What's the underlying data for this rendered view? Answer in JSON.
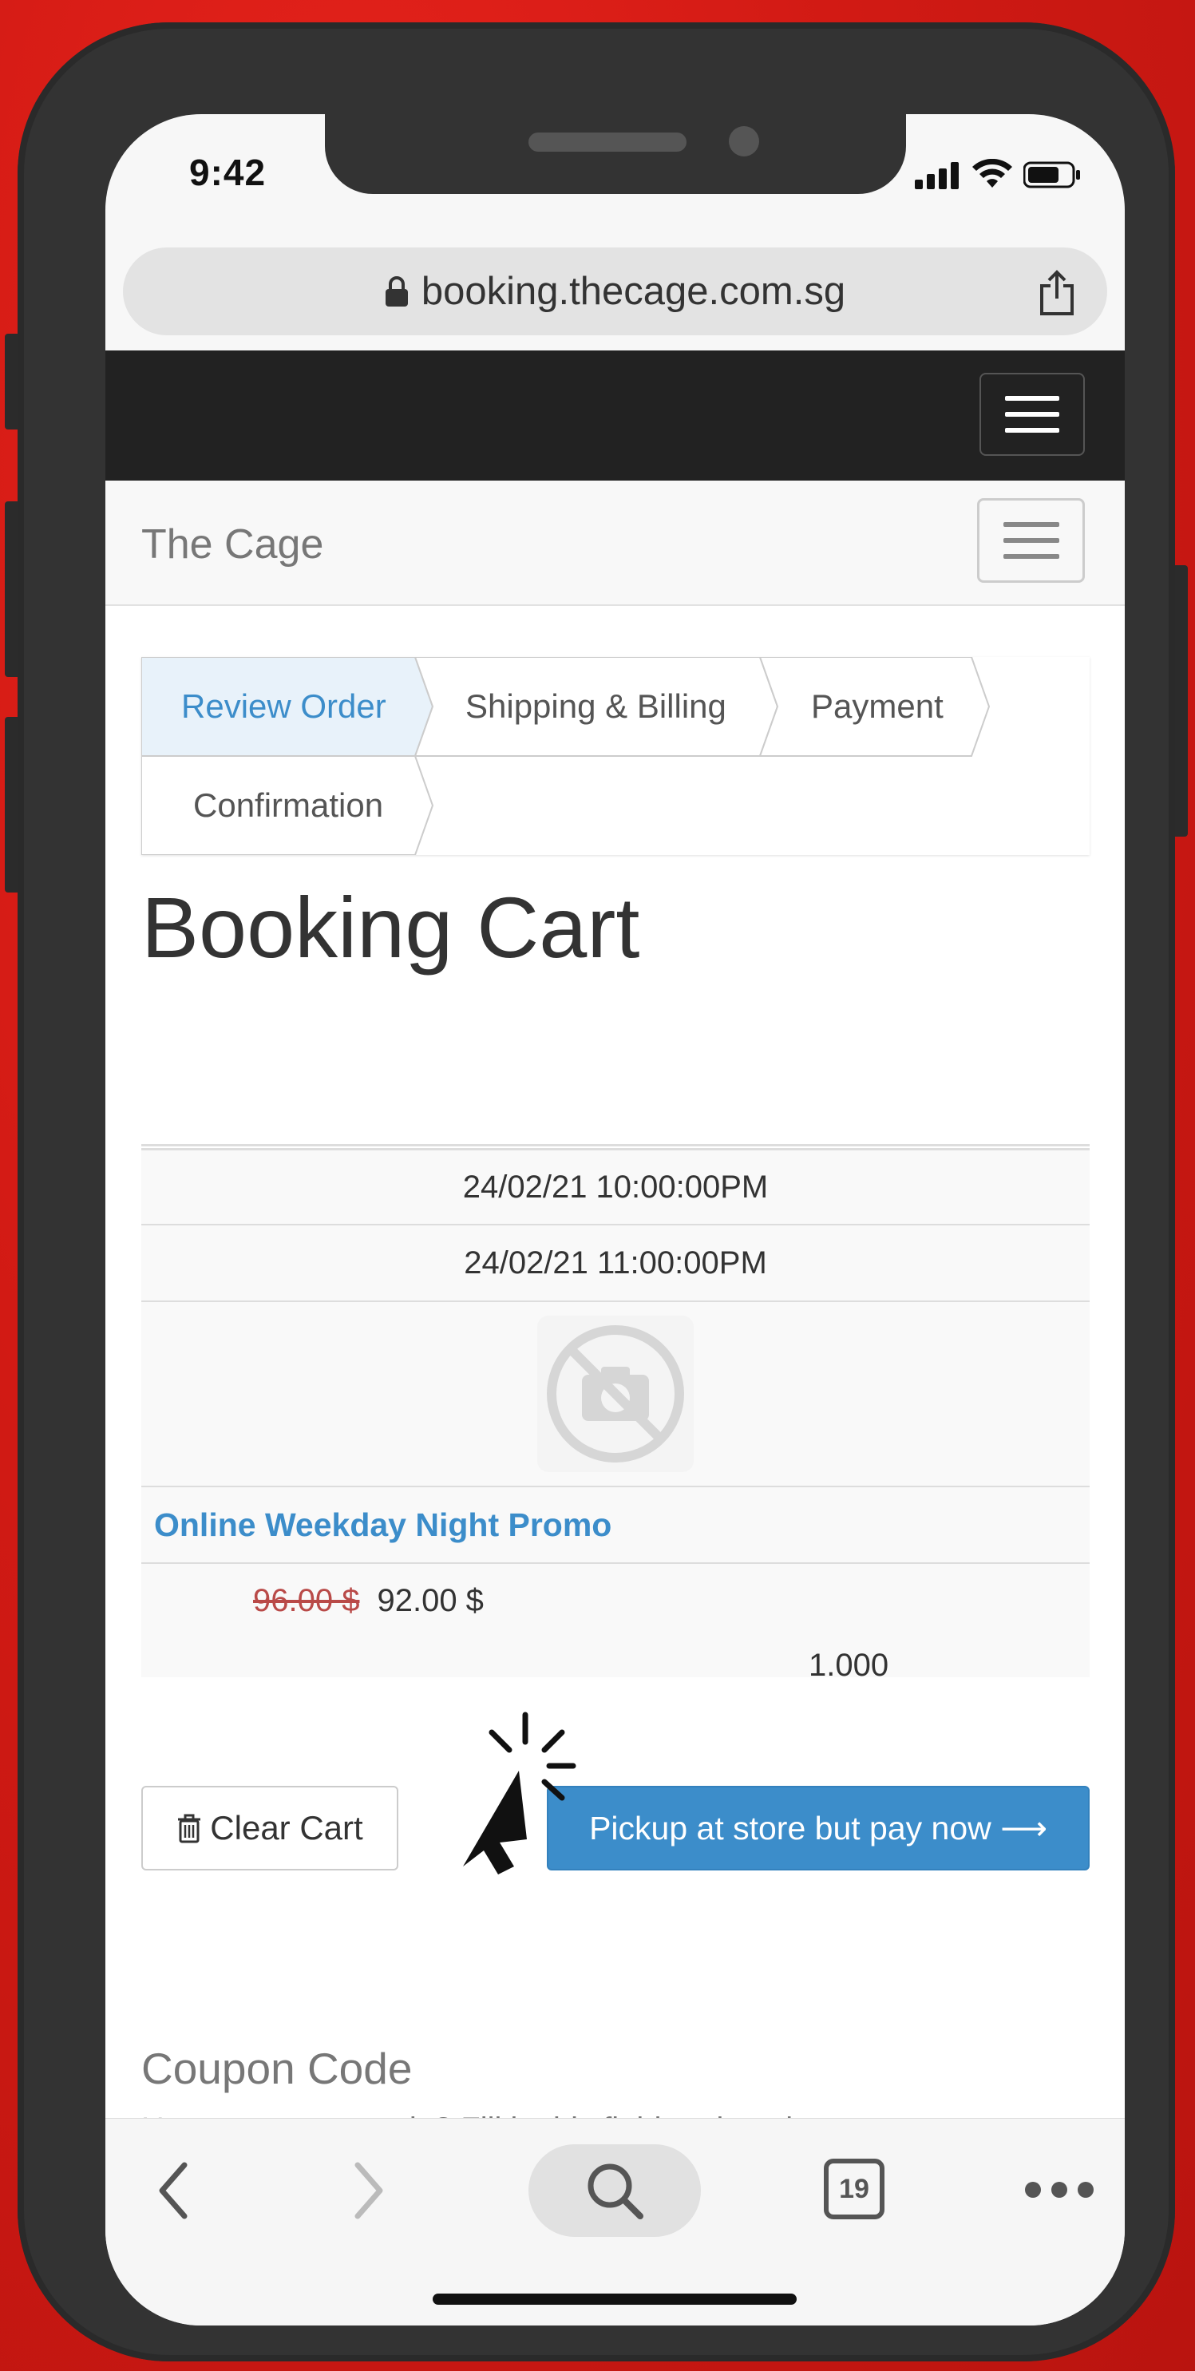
{
  "status_bar": {
    "time": "9:42"
  },
  "browser": {
    "url": "booking.thecage.com.sg",
    "tab_count": "19"
  },
  "navbar": {
    "brand": "The Cage"
  },
  "steps": [
    {
      "label": "Review Order",
      "active": true
    },
    {
      "label": "Shipping & Billing",
      "active": false
    },
    {
      "label": "Payment",
      "active": false
    },
    {
      "label": "Confirmation",
      "active": false
    }
  ],
  "page": {
    "title": "Booking Cart"
  },
  "cart": {
    "start_time": "24/02/21 10:00:00PM",
    "end_time": "24/02/21 11:00:00PM",
    "product_name": "Online Weekday Night Promo",
    "price_old": "96.00 $",
    "price_new": "92.00 $",
    "quantity": "1.000"
  },
  "actions": {
    "clear_cart": "Clear Cart",
    "checkout": "Pickup at store but pay now ⟶"
  },
  "coupon": {
    "title": "Coupon Code",
    "help": "Have a coupon code? Fill in this field and apply."
  },
  "colors": {
    "background": "#d11a14",
    "accent": "#3c8dca",
    "old_price": "#b94a48"
  }
}
